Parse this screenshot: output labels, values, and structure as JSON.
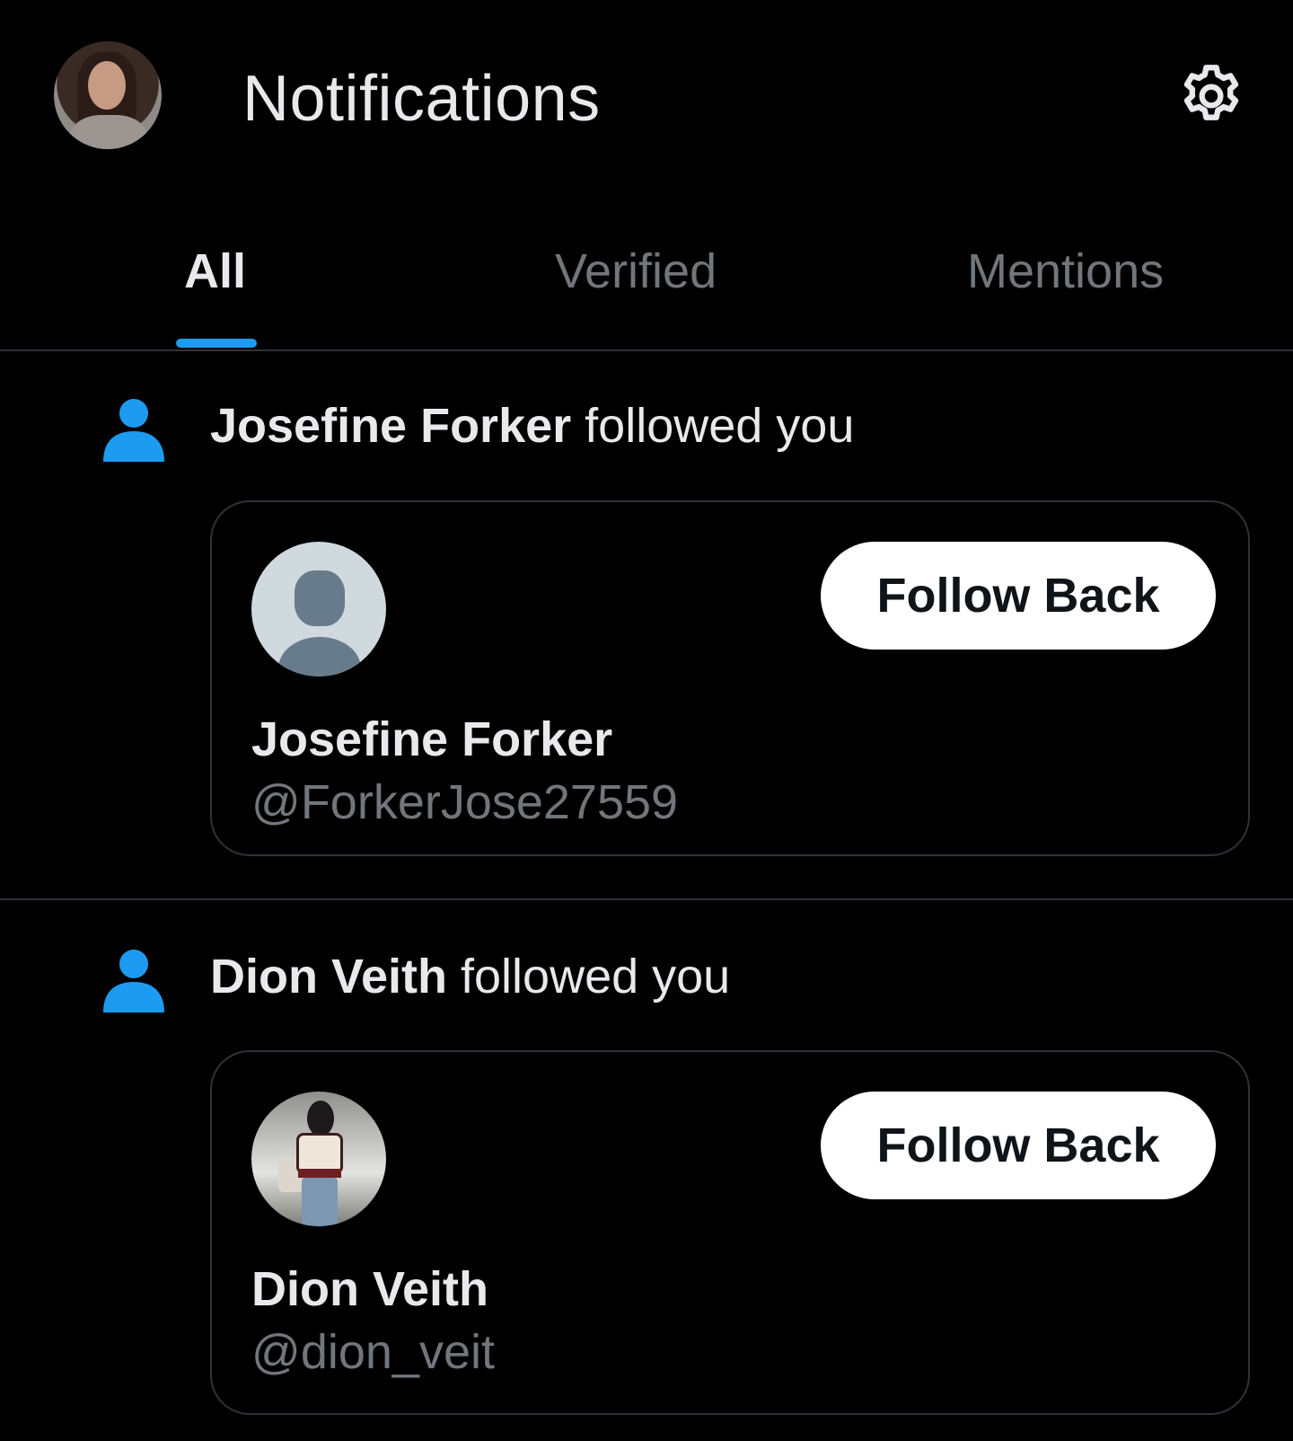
{
  "header": {
    "title": "Notifications",
    "avatar_icon": "profile-avatar",
    "settings_icon": "gear-icon"
  },
  "tabs": [
    {
      "label": "All",
      "active": true
    },
    {
      "label": "Verified",
      "active": false
    },
    {
      "label": "Mentions",
      "active": false
    }
  ],
  "colors": {
    "background": "#000000",
    "accent": "#1d9bf0",
    "text_primary": "#e7e9ea",
    "text_secondary": "#71767b",
    "divider": "#2f3336",
    "button_bg": "#ffffff",
    "button_text": "#0f1419"
  },
  "notifications": [
    {
      "icon": "person-icon",
      "actor": "Josefine Forker",
      "action": " followed you",
      "card": {
        "name": "Josefine Forker",
        "handle": "@ForkerJose27559",
        "button": "Follow Back",
        "avatar": "default-avatar"
      }
    },
    {
      "icon": "person-icon",
      "actor": "Dion Veith",
      "action": " followed you",
      "card": {
        "name": "Dion Veith",
        "handle": "@dion_veit",
        "button": "Follow Back",
        "avatar": "photo-avatar"
      }
    }
  ]
}
